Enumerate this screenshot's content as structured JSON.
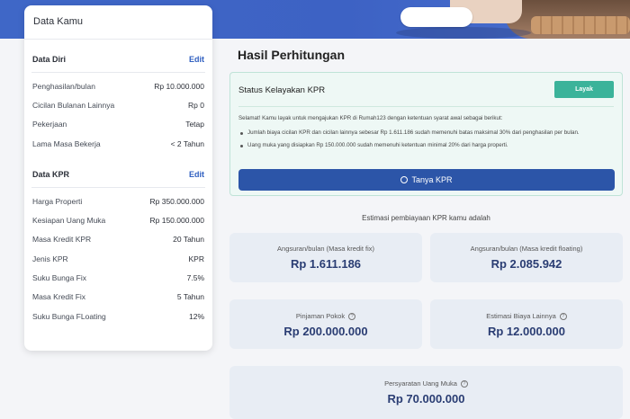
{
  "left_panel": {
    "title": "Data Kamu",
    "data_diri": {
      "heading": "Data Diri",
      "edit_label": "Edit",
      "rows": [
        {
          "label": "Penghasilan/bulan",
          "value": "Rp 10.000.000"
        },
        {
          "label": "Cicilan Bulanan Lainnya",
          "value": "Rp 0"
        },
        {
          "label": "Pekerjaan",
          "value": "Tetap"
        },
        {
          "label": "Lama Masa Bekerja",
          "value": "< 2 Tahun"
        }
      ]
    },
    "data_kpr": {
      "heading": "Data KPR",
      "edit_label": "Edit",
      "rows": [
        {
          "label": "Harga Properti",
          "value": "Rp 350.000.000"
        },
        {
          "label": "Kesiapan Uang Muka",
          "value": "Rp 150.000.000"
        },
        {
          "label": "Masa Kredit KPR",
          "value": "20 Tahun"
        },
        {
          "label": "Jenis KPR",
          "value": "KPR"
        },
        {
          "label": "Suku Bunga Fix",
          "value": "7.5%"
        },
        {
          "label": "Masa Kredit Fix",
          "value": "5 Tahun"
        },
        {
          "label": "Suku Bunga FLoating",
          "value": "12%"
        }
      ]
    }
  },
  "main": {
    "title": "Hasil Perhitungan",
    "status": {
      "title": "Status Kelayakan KPR",
      "badge": "Layak",
      "message": "Selamat! Kamu layak untuk mengajukan KPR di Rumah123 dengan ketentuan syarat awal sebagai berikut:",
      "bullets": [
        "Jumlah biaya cicilan KPR dan cicilan lainnya sebesar Rp 1.611.186 sudah memenuhi batas maksimal 30% dari penghasilan per bulan.",
        "Uang muka yang disiapkan Rp 150.000.000 sudah memenuhi ketentuan minimal 20% dari harga properti."
      ],
      "button_label": "Tanya KPR"
    },
    "estimasi_heading": "Estimasi pembiayaan KPR kamu adalah",
    "cards": {
      "fix": {
        "label": "Angsuran/bulan (Masa kredit fix)",
        "amount": "Rp 1.611.186"
      },
      "floating": {
        "label": "Angsuran/bulan (Masa kredit floating)",
        "amount": "Rp 2.085.942"
      },
      "pokok": {
        "label": "Pinjaman Pokok",
        "amount": "Rp 200.000.000"
      },
      "biaya": {
        "label": "Estimasi Biaya Lainnya",
        "amount": "Rp 12.000.000"
      },
      "uang_muka": {
        "label": "Persyaratan Uang Muka",
        "amount": "Rp 70.000.000"
      }
    }
  },
  "colors": {
    "hero_blue": "#3f67c7",
    "badge_green": "#3bb39a",
    "button_blue": "#2c55a8",
    "amount_navy": "#2a3d73",
    "card_bg": "#e8edf4"
  },
  "icons": {
    "whatsapp": "whatsapp-icon",
    "info": "info-icon"
  }
}
